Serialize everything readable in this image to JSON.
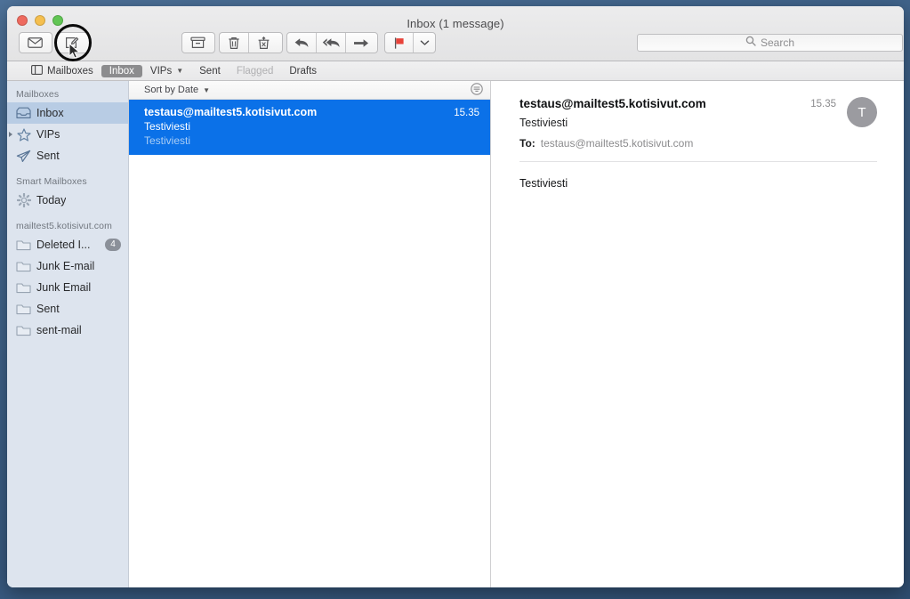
{
  "window": {
    "title": "Inbox (1 message)",
    "traffic_lights": [
      "close",
      "minimize",
      "zoom"
    ]
  },
  "toolbar": {
    "get_mail_label": "Get Mail",
    "compose_label": "New Message",
    "archive_label": "Archive",
    "delete_label": "Delete",
    "junk_label": "Move to Junk",
    "reply_label": "Reply",
    "reply_all_label": "Reply All",
    "forward_label": "Forward",
    "flag_label": "Flag",
    "flag_menu_label": "Flag options",
    "flag_color": "#e8433a"
  },
  "search": {
    "placeholder": "Search",
    "value": "",
    "icon": "search-icon"
  },
  "favorites_bar": {
    "items": [
      {
        "label": "Mailboxes",
        "icon": "sidebar-toggle-icon",
        "selected": false,
        "disabled": false,
        "chevron": false
      },
      {
        "label": "Inbox",
        "icon": "",
        "selected": true,
        "disabled": false,
        "chevron": false
      },
      {
        "label": "VIPs",
        "icon": "",
        "selected": false,
        "disabled": false,
        "chevron": true
      },
      {
        "label": "Sent",
        "icon": "",
        "selected": false,
        "disabled": false,
        "chevron": false
      },
      {
        "label": "Flagged",
        "icon": "",
        "selected": false,
        "disabled": true,
        "chevron": false
      },
      {
        "label": "Drafts",
        "icon": "",
        "selected": false,
        "disabled": false,
        "chevron": false
      }
    ]
  },
  "sidebar": {
    "sections": [
      {
        "header": "Mailboxes",
        "items": [
          {
            "label": "Inbox",
            "icon": "inbox-icon",
            "selected": true,
            "badge": "",
            "disclosure": false
          },
          {
            "label": "VIPs",
            "icon": "star-icon",
            "selected": false,
            "badge": "",
            "disclosure": true
          },
          {
            "label": "Sent",
            "icon": "paper-plane-icon",
            "selected": false,
            "badge": "",
            "disclosure": false
          }
        ]
      },
      {
        "header": "Smart Mailboxes",
        "items": [
          {
            "label": "Today",
            "icon": "gear-icon",
            "selected": false,
            "badge": "",
            "disclosure": false
          }
        ]
      },
      {
        "header": "mailtest5.kotisivut.com",
        "items": [
          {
            "label": "Deleted I...",
            "icon": "folder-icon",
            "selected": false,
            "badge": "4",
            "disclosure": false
          },
          {
            "label": "Junk E-mail",
            "icon": "folder-icon",
            "selected": false,
            "badge": "",
            "disclosure": false
          },
          {
            "label": "Junk Email",
            "icon": "folder-icon",
            "selected": false,
            "badge": "",
            "disclosure": false
          },
          {
            "label": "Sent",
            "icon": "folder-icon",
            "selected": false,
            "badge": "",
            "disclosure": false
          },
          {
            "label": "sent-mail",
            "icon": "folder-icon",
            "selected": false,
            "badge": "",
            "disclosure": false
          }
        ]
      }
    ]
  },
  "message_list": {
    "sort_label": "Sort by Date",
    "filter_icon": "filter-lines-icon",
    "messages": [
      {
        "sender": "testaus@mailtest5.kotisivut.com",
        "time": "15.35",
        "subject": "Testiviesti",
        "preview": "Testiviesti",
        "selected": true
      }
    ]
  },
  "message_detail": {
    "sender": "testaus@mailtest5.kotisivut.com",
    "time": "15.35",
    "subject": "Testiviesti",
    "to_label": "To:",
    "to_value": "testaus@mailtest5.kotisivut.com",
    "avatar_initial": "T",
    "body": "Testiviesti"
  },
  "annotation": {
    "target": "compose-button",
    "shape": "circle",
    "color": "#0a0a0a"
  }
}
